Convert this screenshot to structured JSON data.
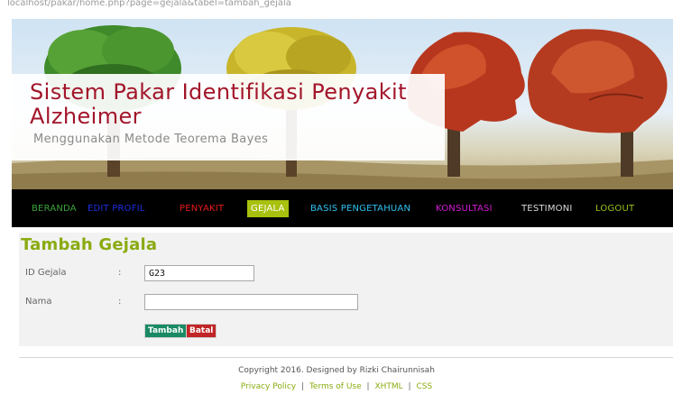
{
  "browser": {
    "url": "localhost/pakar/home.php?page=gejala&tabel=tambah_gejala"
  },
  "header": {
    "title": "Sistem Pakar Identifikasi Penyakit Alzheimer",
    "subtitle": "Menggunakan Metode Teorema Bayes"
  },
  "nav": {
    "items": [
      {
        "label": "BERANDA",
        "color": "#3aa23a"
      },
      {
        "label": "EDIT PROFIL",
        "color": "#1d2fe0"
      },
      {
        "label": "PENYAKIT",
        "color": "#e81b1b"
      },
      {
        "label": "GEJALA",
        "color": "#ffffff",
        "active": true
      },
      {
        "label": "BASIS PENGETAHUAN",
        "color": "#2fc0f0"
      },
      {
        "label": "KONSULTASI",
        "color": "#d41ad4"
      },
      {
        "label": "TESTIMONI",
        "color": "#d9d9d9"
      },
      {
        "label": "LOGOUT",
        "color": "#9bc21c"
      }
    ],
    "active_bg": "#a7c10e"
  },
  "form": {
    "title": "Tambah Gejala",
    "fields": [
      {
        "label": "ID Gejala",
        "colon": ":",
        "value": "G23"
      },
      {
        "label": "Nama",
        "colon": ":",
        "value": ""
      }
    ],
    "buttons": {
      "submit": {
        "label": "Tambah",
        "color": "#1a8a64"
      },
      "cancel": {
        "label": "Batal",
        "color": "#c22526"
      }
    }
  },
  "footer": {
    "copyright": "Copyright 2016. Designed by Rizki Chairunnisah",
    "links": [
      "Privacy Policy",
      "Terms of Use",
      "XHTML",
      "CSS"
    ],
    "separator": "|"
  }
}
